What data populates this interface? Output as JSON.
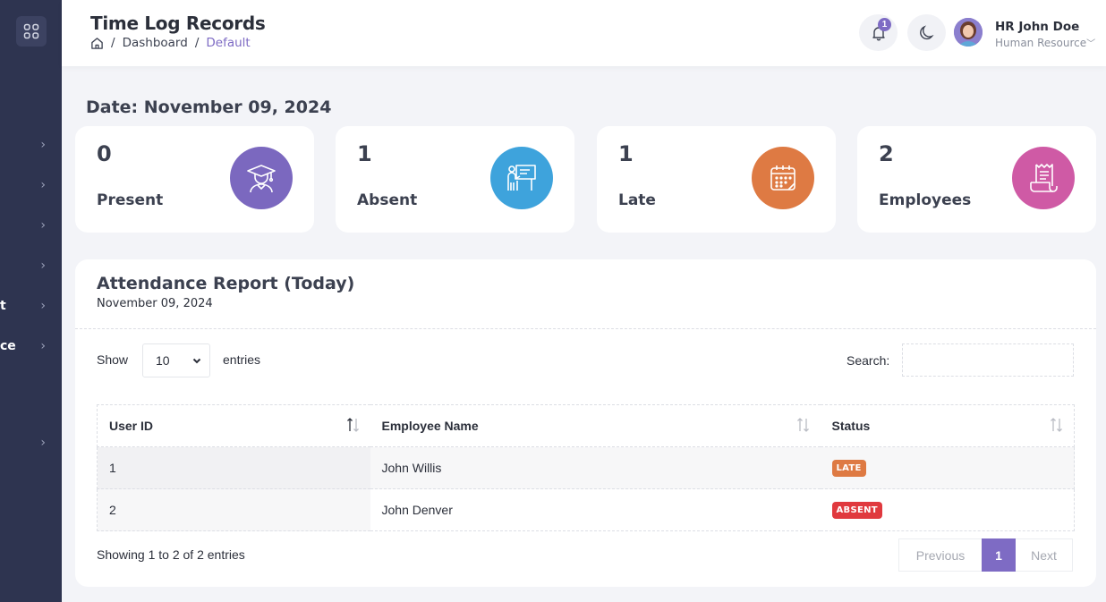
{
  "header": {
    "title": "Time Log Records",
    "breadcrumb": [
      "Dashboard",
      "Default"
    ],
    "notification_count": "1",
    "user_name": "HR John Doe",
    "user_role": "Human Resource"
  },
  "sidebar": {
    "partial_labels": [
      "t",
      "ce"
    ]
  },
  "date_heading": "Date: November 09, 2024",
  "stats": [
    {
      "value": "0",
      "label": "Present",
      "color": "#7b68bf",
      "icon": "graduate-icon"
    },
    {
      "value": "1",
      "label": "Absent",
      "color": "#3ea3dc",
      "icon": "teacher-board-icon"
    },
    {
      "value": "1",
      "label": "Late",
      "color": "#de7a43",
      "icon": "calendar-icon"
    },
    {
      "value": "2",
      "label": "Employees",
      "color": "#cf5aa5",
      "icon": "receipt-icon"
    }
  ],
  "report": {
    "title": "Attendance Report (Today)",
    "date": "November 09, 2024",
    "show_label": "Show",
    "entries_value": "10",
    "entries_label": "entries",
    "search_label": "Search:",
    "search_value": "",
    "columns": [
      "User ID",
      "Employee Name",
      "Status"
    ],
    "rows": [
      {
        "user_id": "1",
        "name": "John Willis",
        "status": "LATE",
        "status_color": "#de7a43"
      },
      {
        "user_id": "2",
        "name": "John Denver",
        "status": "ABSENT",
        "status_color": "#e0393e"
      }
    ],
    "info": "Showing 1 to 2 of 2 entries",
    "pagination": {
      "previous": "Previous",
      "current": "1",
      "next": "Next"
    }
  }
}
